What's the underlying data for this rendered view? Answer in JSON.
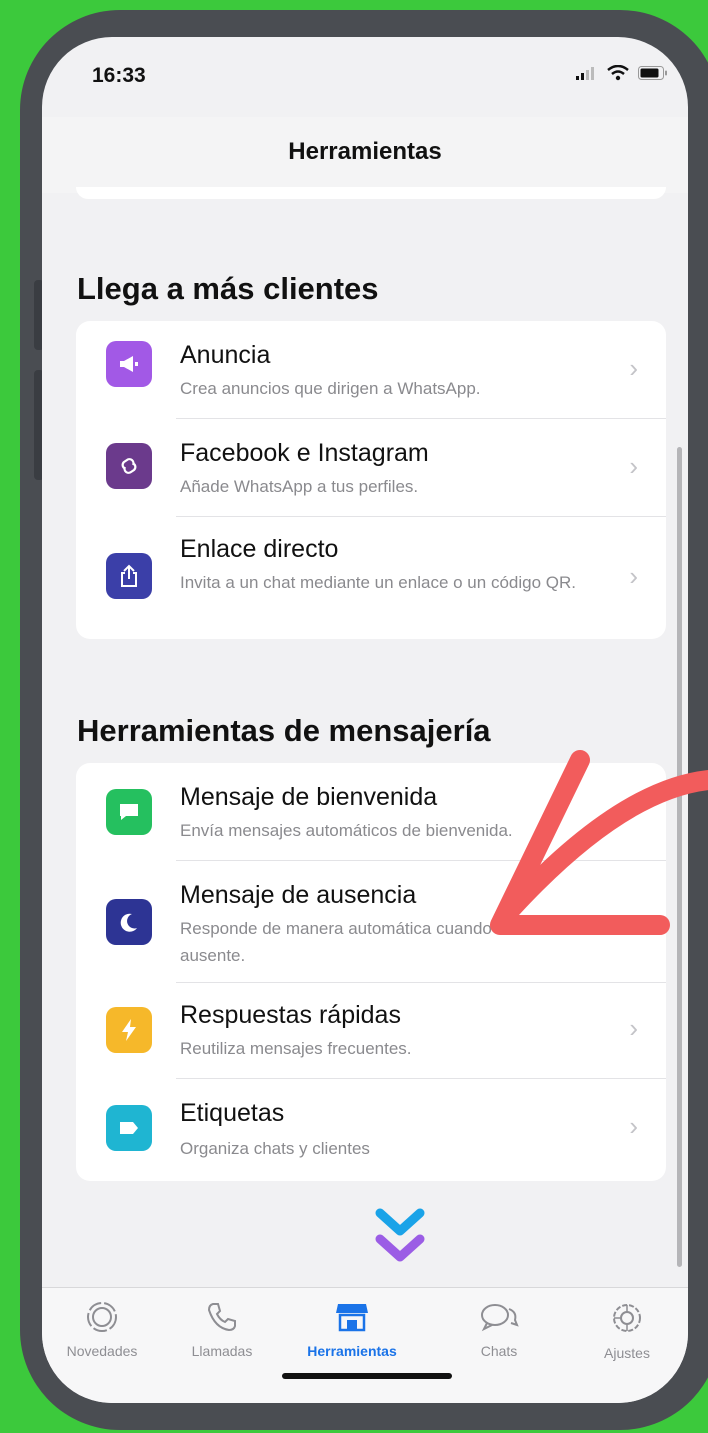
{
  "status_bar": {
    "time": "16:33"
  },
  "header": {
    "title": "Herramientas"
  },
  "sections": [
    {
      "title": "Llega a más clientes",
      "items": [
        {
          "title": "Anuncia",
          "subtitle": "Crea anuncios que dirigen a WhatsApp.",
          "icon": "megaphone-icon",
          "color": "#a259e6"
        },
        {
          "title": "Facebook e Instagram",
          "subtitle": "Añade WhatsApp a tus perfiles.",
          "icon": "link-icon",
          "color": "#6b3a8c"
        },
        {
          "title": "Enlace directo",
          "subtitle": "Invita a un chat mediante un enlace o un código QR.",
          "icon": "share-icon",
          "color": "#3b3fa8"
        }
      ]
    },
    {
      "title": "Herramientas de mensajería",
      "items": [
        {
          "title": "Mensaje de bienvenida",
          "subtitle": "Envía mensajes automáticos de bienvenida.",
          "icon": "chat-bubble-icon",
          "color": "#25c05f"
        },
        {
          "title": "Mensaje de ausencia",
          "subtitle": "Responde de manera automática cuando estés ausente.",
          "icon": "moon-icon",
          "color": "#2d3494"
        },
        {
          "title": "Respuestas rápidas",
          "subtitle": "Reutiliza mensajes frecuentes.",
          "icon": "lightning-icon",
          "color": "#f6b82a"
        },
        {
          "title": "Etiquetas",
          "subtitle": "Organiza chats y clientes",
          "icon": "label-tag-icon",
          "color": "#1fb5d2"
        }
      ]
    }
  ],
  "tabs": [
    {
      "label": "Novedades",
      "icon": "updates-icon",
      "active": false
    },
    {
      "label": "Llamadas",
      "icon": "phone-icon",
      "active": false
    },
    {
      "label": "Herramientas",
      "icon": "store-icon",
      "active": true
    },
    {
      "label": "Chats",
      "icon": "chats-icon",
      "active": false
    },
    {
      "label": "Ajustes",
      "icon": "settings-icon",
      "active": false
    }
  ],
  "colors": {
    "background": "#3cc93c",
    "accent": "#1a73e8",
    "arrow": "#f25c5c",
    "chevron_blue": "#1aa3e8",
    "chevron_purple": "#9b5de5"
  }
}
